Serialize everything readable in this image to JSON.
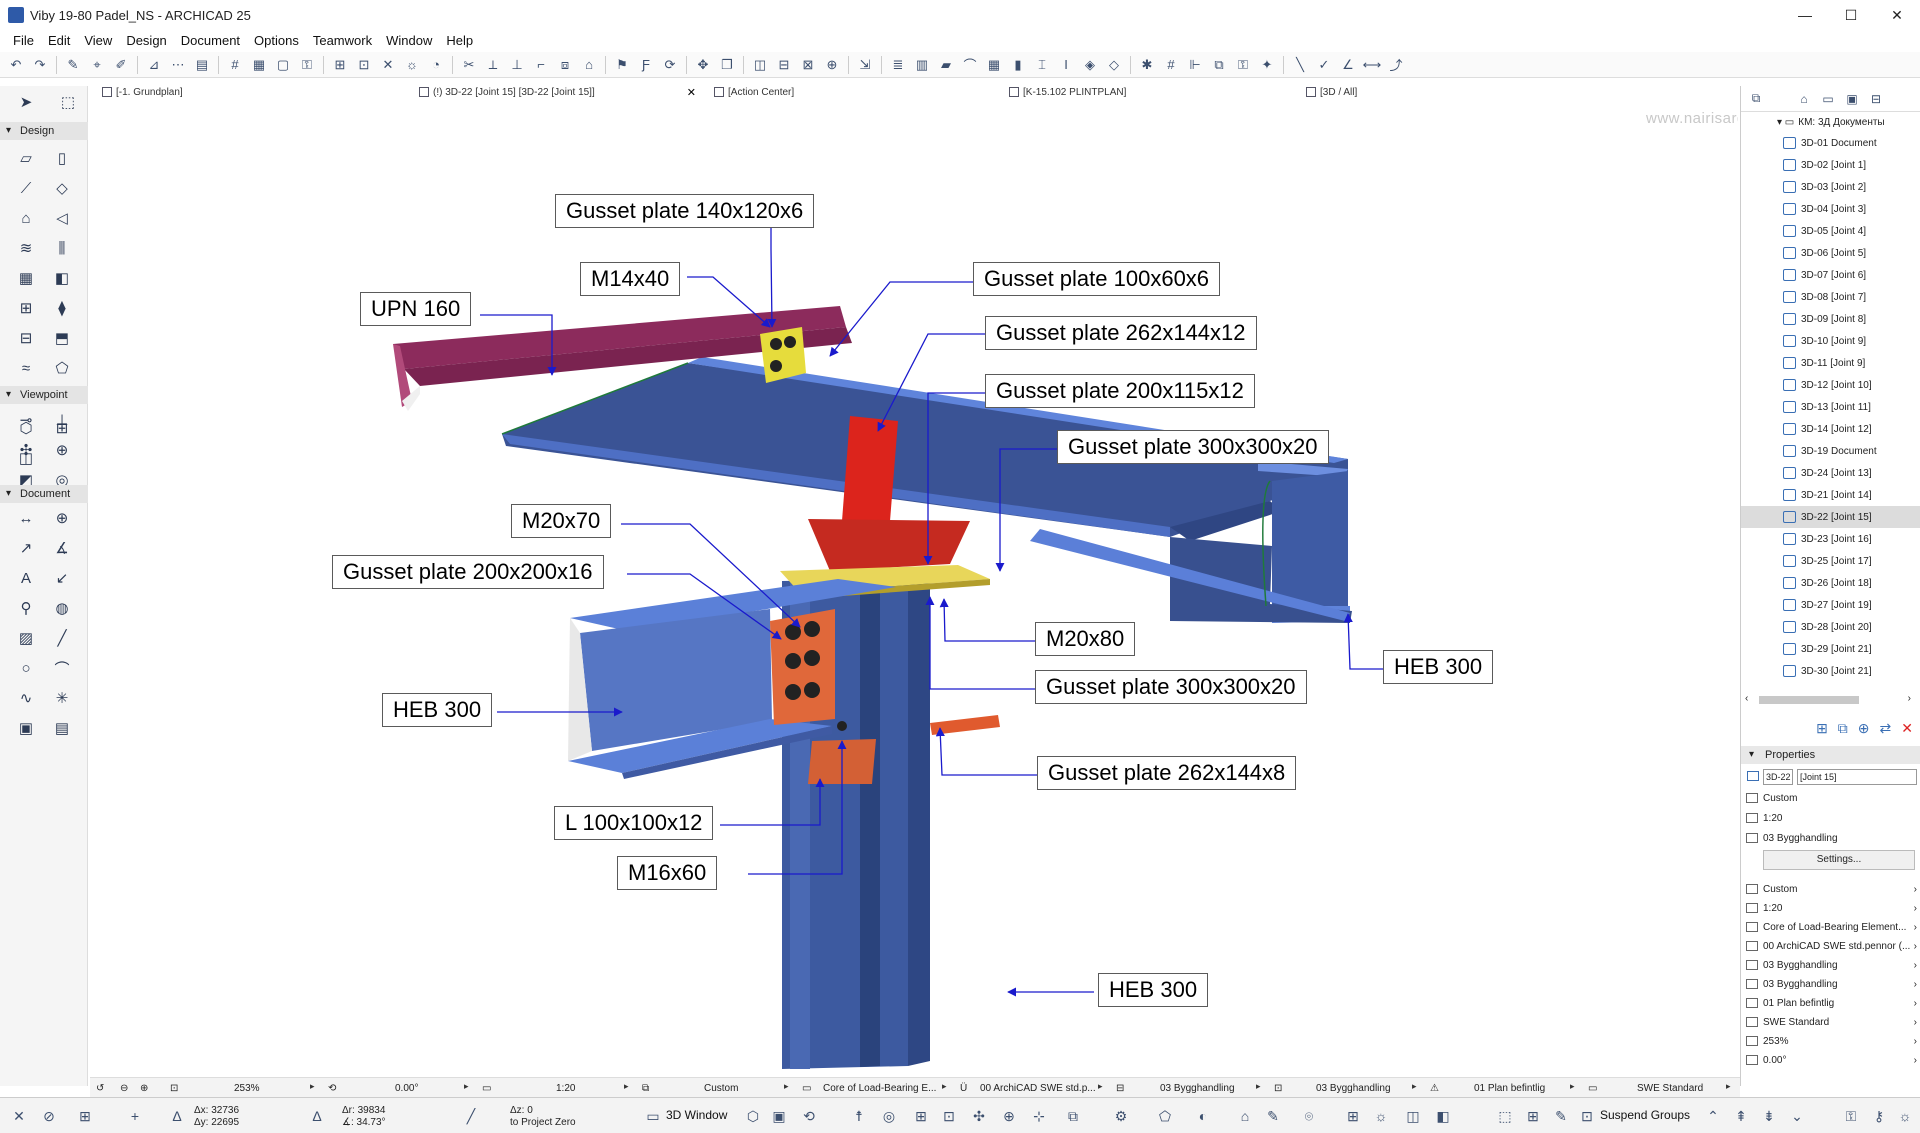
{
  "window": {
    "title": "Viby 19-80 Padel_NS - ARCHICAD 25",
    "minimize": "—",
    "maximize": "☐",
    "close": "✕"
  },
  "menu": [
    "File",
    "Edit",
    "View",
    "Design",
    "Document",
    "Options",
    "Teamwork",
    "Window",
    "Help"
  ],
  "tabs": {
    "plan": "[-1. Grundplan]",
    "active": "(!) 3D-22 [Joint 15] [3D-22 [Joint 15]]",
    "action_center": "[Action Center]",
    "plintplan": "[K-15.102 PLINTPLAN]",
    "all3d": "[3D / All]"
  },
  "toolbox": {
    "design": "Design",
    "viewpoint": "Viewpoint",
    "document": "Document"
  },
  "canvas": {
    "watermark": "www.nairisargsyan.com",
    "labels": {
      "gusset_140": "Gusset plate 140x120x6",
      "upn160": "UPN 160",
      "m14x40": "M14x40",
      "gusset_100": "Gusset plate 100x60x6",
      "gusset_262_12": "Gusset plate 262x144x12",
      "gusset_200_115": "Gusset plate 200x115x12",
      "gusset_300_top": "Gusset plate 300x300x20",
      "m20x70": "M20x70",
      "gusset_200_200": "Gusset plate 200x200x16",
      "heb300_left": "HEB 300",
      "m20x80": "M20x80",
      "gusset_300_mid": "Gusset plate 300x300x20",
      "heb300_right": "HEB 300",
      "gusset_262_8": "Gusset plate 262x144x8",
      "l100": "L 100x100x12",
      "m16x60": "M16x60",
      "heb300_bottom": "HEB 300"
    },
    "colors": {
      "beam_blue": "#5a7fd6",
      "beam_dark": "#344c8a",
      "upn": "#8c2b5c",
      "plate_red": "#e0261e",
      "plate_orange": "#e06a35",
      "plate_yellow": "#e6dc3c",
      "leader": "#1a1acc"
    }
  },
  "navigator": {
    "folder": "КМ: 3Д Документы",
    "items": [
      "3D-01 Document",
      "3D-02 [Joint 1]",
      "3D-03 [Joint 2]",
      "3D-04 [Joint 3]",
      "3D-05 [Joint 4]",
      "3D-06 [Joint 5]",
      "3D-07 [Joint 6]",
      "3D-08 [Joint 7]",
      "3D-09 [Joint 8]",
      "3D-10 [Joint 9]",
      "3D-11 [Joint 9]",
      "3D-12 [Joint 10]",
      "3D-13 [Joint 11]",
      "3D-14 [Joint 12]",
      "3D-19 Document",
      "3D-24 [Joint 13]",
      "3D-21 [Joint 14]",
      "3D-22 [Joint 15]",
      "3D-23 [Joint 16]",
      "3D-25 [Joint 17]",
      "3D-26 [Joint 18]",
      "3D-27 [Joint 19]",
      "3D-28 [Joint 20]",
      "3D-29 [Joint 21]",
      "3D-30 [Joint 21]"
    ],
    "selected_index": 17
  },
  "properties": {
    "header": "Properties",
    "id": "3D-22",
    "name": "[Joint 15]",
    "rows_top": [
      "Custom",
      "1:20",
      "03 Bygghandling"
    ],
    "settings": "Settings...",
    "rows": [
      "Custom",
      "1:20",
      "Core of Load-Bearing Element...",
      "00 ArchiCAD SWE std.pennor (...",
      "03 Bygghandling",
      "03 Bygghandling",
      "01 Plan befintlig",
      "SWE Standard",
      "253%",
      "0.00°"
    ]
  },
  "statusbar": {
    "zoom": "253%",
    "angle": "0.00°",
    "scale": "1:20",
    "custom": "Custom",
    "core": "Core of Load-Bearing E...",
    "pen": "00 ArchiCAD SWE std.p...",
    "bygg1": "03 Bygghandling",
    "bygg2": "03 Bygghandling",
    "plan": "01 Plan befintlig",
    "standard": "SWE Standard"
  },
  "coords": {
    "dx": "Δx: 32736",
    "dy": "Δy: 22695",
    "dr": "Δr: 39834",
    "da": "∡: 34.73°",
    "dz": "Δz: 0",
    "dz_ref": "to Project Zero"
  },
  "bottombar": {
    "window3d": "3D Window",
    "suspend": "Suspend Groups"
  }
}
